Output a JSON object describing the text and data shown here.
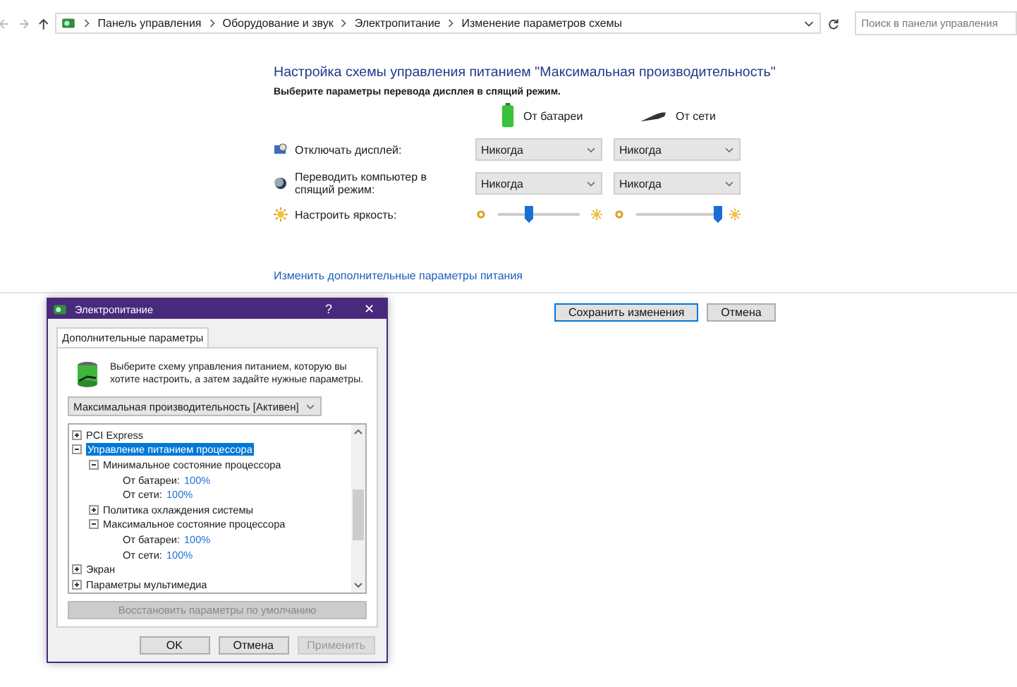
{
  "address_bar": {
    "breadcrumbs": [
      "Панель управления",
      "Оборудование и звук",
      "Электропитание",
      "Изменение параметров схемы"
    ],
    "search": {
      "placeholder": "Поиск в панели управления"
    }
  },
  "plan": {
    "title": "Настройка схемы управления питанием \"Максимальная производительность\"",
    "subtitle": "Выберите параметры перевода дисплея в спящий режим.",
    "columns": [
      "От батареи",
      "От сети"
    ],
    "rows": [
      {
        "kind": "select",
        "label": "Отключать дисплей:",
        "values": [
          "Никогда",
          "Никогда"
        ]
      },
      {
        "kind": "select",
        "label": "Переводить компьютер в спящий режим:",
        "values": [
          "Никогда",
          "Никогда"
        ]
      },
      {
        "kind": "slider",
        "label": "Настроить яркость:",
        "levels": [
          {
            "level": 0.38
          },
          {
            "level": 1.0
          }
        ]
      }
    ],
    "advanced_link": "Изменить дополнительные параметры питания",
    "buttons": [
      {
        "label": "Сохранить изменения",
        "default": true
      },
      {
        "label": "Отмена",
        "default": false
      }
    ]
  },
  "dialog": {
    "title": "Электропитание",
    "help": "?",
    "close": "✕",
    "tab": "Дополнительные параметры",
    "intro": "Выберите схему управления питанием, которую вы хотите настроить, а затем задайте нужные параметры.",
    "scheme": "Максимальная производительность [Активен]",
    "tree": [
      {
        "label": "PCI Express",
        "expanded": false,
        "selected": false
      },
      {
        "label": "Управление питанием процессора",
        "expanded": true,
        "selected": true,
        "children": [
          {
            "label": "Минимальное состояние процессора",
            "expanded": true,
            "selected": false,
            "children": [
              {
                "kind": "setting",
                "label": "От батареи:",
                "value": "100%"
              },
              {
                "kind": "setting",
                "label": "От сети:",
                "value": "100%"
              }
            ]
          },
          {
            "label": "Политика охлаждения системы",
            "expanded": false,
            "selected": false
          },
          {
            "label": "Максимальное состояние процессора",
            "expanded": true,
            "selected": false,
            "children": [
              {
                "kind": "setting",
                "label": "От батареи:",
                "value": "100%"
              },
              {
                "kind": "setting",
                "label": "От сети:",
                "value": "100%"
              }
            ]
          }
        ]
      },
      {
        "label": "Экран",
        "expanded": false,
        "selected": false
      },
      {
        "label": "Параметры мультимедиа",
        "expanded": false,
        "selected": false
      }
    ],
    "restore_button": {
      "label": "Восстановить параметры по умолчанию",
      "disabled": true
    },
    "buttons": [
      {
        "label": "OK",
        "disabled": false
      },
      {
        "label": "Отмена",
        "disabled": false
      },
      {
        "label": "Применить",
        "disabled": true
      }
    ]
  }
}
